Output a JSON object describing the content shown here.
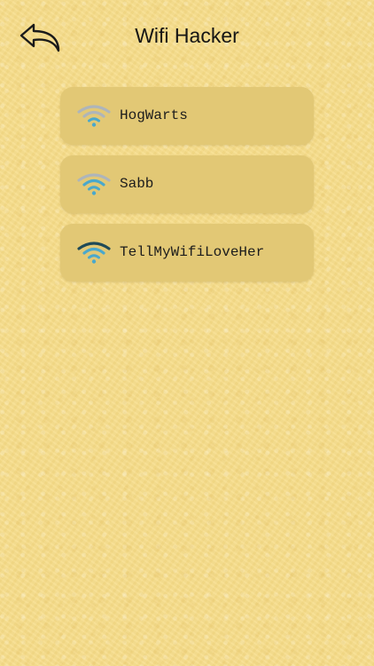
{
  "header": {
    "title": "Wifi Hacker",
    "back_icon": "back-arrow-icon"
  },
  "networks": [
    {
      "name": "HogWarts",
      "signal_bars": 1,
      "icon": "wifi-signal-icon"
    },
    {
      "name": "Sabb",
      "signal_bars": 2,
      "icon": "wifi-signal-icon"
    },
    {
      "name": "TellMyWifiLoveHer",
      "signal_bars": 3,
      "icon": "wifi-signal-icon"
    }
  ],
  "colors": {
    "background": "#f7dd8a",
    "card": "#e2c875",
    "signal_active_dark": "#1f4a57",
    "signal_active_blue": "#4aa8cc",
    "signal_inactive": "#aeb5ba"
  }
}
